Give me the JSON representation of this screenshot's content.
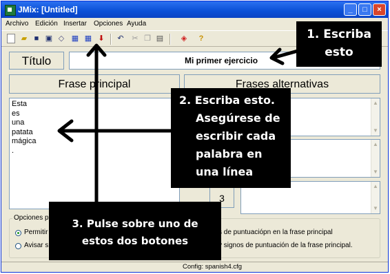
{
  "window": {
    "title": "JMix: [Untitled]"
  },
  "menu": [
    "Archivo",
    "Edición",
    "Insertar",
    "Opciones",
    "Ayuda"
  ],
  "title_field": {
    "label": "Título",
    "value": "Mi primer ejercicio"
  },
  "main_sentence": {
    "header": "Frase principal",
    "lines": [
      "Esta",
      "es",
      "una",
      "patata",
      "mágica",
      "."
    ]
  },
  "alternatives": {
    "header": "Frases alternativas",
    "index_3": "3"
  },
  "options": {
    "group_title": "Opciones p",
    "opt1_visible": "Permitir",
    "opt1_rest": "s de puntuaciópn en la frase principal",
    "opt2_visible": "Avisar s",
    "opt2_rest": "y signos de puntuación de la frase principal."
  },
  "status": "Config: spanish4.cfg",
  "callouts": {
    "c1_line1": "1. Escriba",
    "c1_line2": "esto",
    "c2_lines": [
      "2. Escriba esto.",
      "Asegúrese de",
      "escribir cada",
      "palabra en",
      "una línea"
    ],
    "c3_line1": "3. Pulse sobre uno de",
    "c3_line2": "estos dos botones"
  },
  "icons": [
    "new-icon",
    "open-icon",
    "save-icon",
    "save-as-icon",
    "clear-icon",
    "web-export-icon",
    "web-export-drag-icon",
    "stop-icon",
    "undo-icon",
    "cut-icon",
    "copy-icon",
    "paste-icon",
    "config-icon",
    "help-icon"
  ],
  "colors": {
    "titlebar": "#0a4fd6",
    "callout": "#000000"
  }
}
